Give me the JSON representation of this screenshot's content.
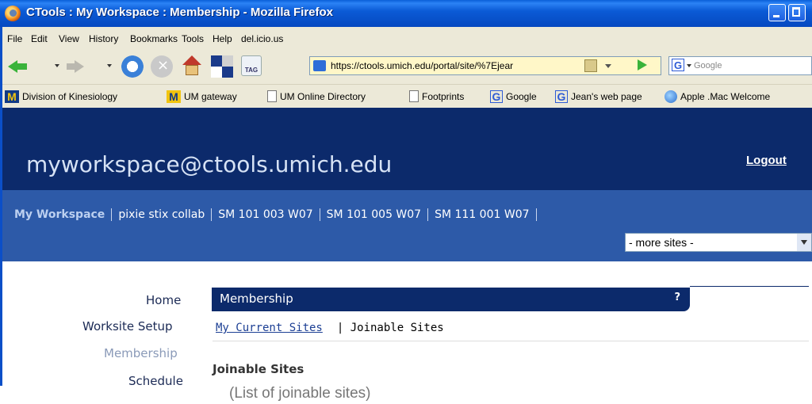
{
  "window": {
    "title": "CTools : My Workspace : Membership - Mozilla Firefox"
  },
  "menubar": {
    "items": [
      "File",
      "Edit",
      "View",
      "History",
      "Bookmarks",
      "Tools",
      "Help",
      "del.icio.us"
    ]
  },
  "toolbar": {
    "url": "https://ctools.umich.edu/portal/site/%7Ejear",
    "search_placeholder": "Google",
    "tag_label": "TAG"
  },
  "bookmarks": {
    "items": [
      {
        "icon": "m-logo-icon",
        "label": "Division of Kinesiology"
      },
      {
        "icon": "m-logo-icon",
        "label": "UM gateway"
      },
      {
        "icon": "page-icon",
        "label": "UM Online Directory"
      },
      {
        "icon": "page-icon",
        "label": "Footprints"
      },
      {
        "icon": "google-icon",
        "label": "Google"
      },
      {
        "icon": "google-icon",
        "label": "Jean's web page"
      },
      {
        "icon": "globe-icon",
        "label": "Apple .Mac Welcome"
      }
    ]
  },
  "site": {
    "title": "myworkspace@ctools.umich.edu",
    "logout": "Logout",
    "tabs": [
      "My Workspace",
      "pixie stix collab",
      "SM 101 003 W07",
      "SM 101 005 W07",
      "SM 111 001 W07"
    ],
    "more_sites": "- more sites -"
  },
  "leftnav": {
    "items": [
      "Home",
      "Worksite Setup",
      "Membership",
      "Schedule"
    ],
    "selected": "Membership"
  },
  "tool": {
    "title": "Membership",
    "help": "?",
    "subnav_current": "My Current Sites",
    "subnav_joinable": "| Joinable Sites",
    "section_title": "Joinable Sites"
  },
  "caption": "(List of joinable sites)",
  "colors": {
    "banner": "#0c2a6b",
    "tabs_bar": "#2d5aa8",
    "link": "#1c3f94"
  }
}
